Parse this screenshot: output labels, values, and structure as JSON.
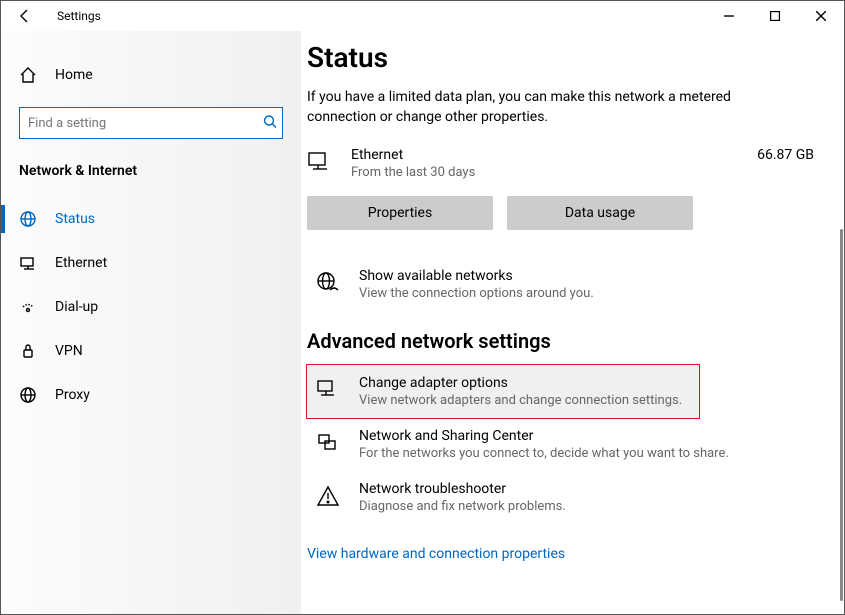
{
  "titlebar": {
    "title": "Settings"
  },
  "sidebar": {
    "home_label": "Home",
    "search_placeholder": "Find a setting",
    "category_label": "Network & Internet",
    "items": [
      {
        "label": "Status"
      },
      {
        "label": "Ethernet"
      },
      {
        "label": "Dial-up"
      },
      {
        "label": "VPN"
      },
      {
        "label": "Proxy"
      }
    ]
  },
  "content": {
    "page_title": "Status",
    "description": "If you have a limited data plan, you can make this network a metered connection or change other properties.",
    "connection": {
      "name": "Ethernet",
      "subtitle": "From the last 30 days",
      "usage": "66.87 GB"
    },
    "buttons": {
      "properties": "Properties",
      "data_usage": "Data usage"
    },
    "available_networks": {
      "title": "Show available networks",
      "subtitle": "View the connection options around you."
    },
    "advanced_section_title": "Advanced network settings",
    "adapter": {
      "title": "Change adapter options",
      "subtitle": "View network adapters and change connection settings."
    },
    "sharing": {
      "title": "Network and Sharing Center",
      "subtitle": "For the networks you connect to, decide what you want to share."
    },
    "troubleshooter": {
      "title": "Network troubleshooter",
      "subtitle": "Diagnose and fix network problems."
    },
    "hardware_link": "View hardware and connection properties"
  }
}
